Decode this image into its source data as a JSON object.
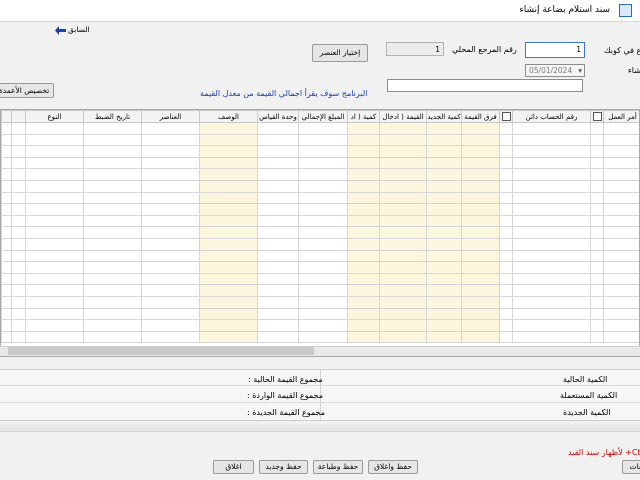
{
  "window": {
    "title": "سند استلام بضاعة إنشاء"
  },
  "toolbar": {
    "back_label": "السابق",
    "back_icon": "arrow-left-icon"
  },
  "fields": {
    "ref_label": "رقم المرجع المحلي",
    "ref_value": "1",
    "cut_label": "ع في كوبك",
    "cut_value": "1",
    "date_label": "شاء",
    "date_value": "05/01/2024",
    "choose_element_label": "إختيار العنصر",
    "allocate_label": "تخصيص الأعمدة",
    "note": "البرنامج سوف يقرأ اجمالي القيمة من معدل القيمة"
  },
  "grid": {
    "columns": [
      "",
      "",
      "النوع",
      "تاريخ الضبط",
      "العناصر",
      "الوصف",
      "وحدة القياس",
      "المبلغ الإجمالي",
      "كمية ( اد",
      "القيمة ( ادخال",
      "كمية الجديد",
      "فرق القيمة",
      "",
      "رقم الحساب دائن",
      "",
      "أمر العمل"
    ],
    "row_count": 19
  },
  "totals": {
    "current_qty": "الكمية الحالية",
    "used_qty": "الكمية المستعملة",
    "new_qty": "الكمية الجديدة",
    "current_value": "مجموع القيمة الحالية :",
    "incoming_value": "مجموع القيمة الواردة :",
    "new_value": "مجموع القيمة الجديدة :"
  },
  "footer": {
    "hint": "Ctrl+ لأظهار سند القيد",
    "attachments": "مرفقات",
    "save_close": "حفظ واغلاق",
    "save_print": "حفظ وطباعة",
    "save_new": "حفظ وجديد",
    "close": "اغلاق"
  }
}
